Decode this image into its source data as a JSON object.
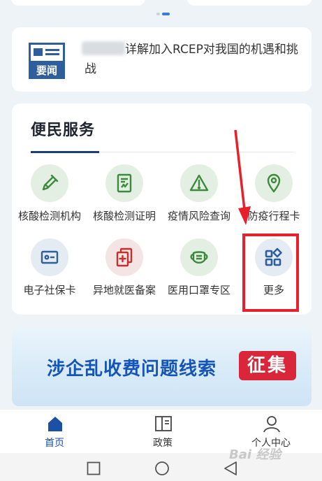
{
  "colors": {
    "brand_blue": "#1d4fa6",
    "accent_red": "#e8202b",
    "icon_green": "#3d8a3c",
    "icon_blue": "#2e5e9b",
    "icon_red": "#c2312e"
  },
  "carousel": {
    "active_index": 1,
    "count": 2
  },
  "news": {
    "icon": "news-headline-icon",
    "icon_label": "要闻",
    "text": "详解加入RCEP对我国的机遇和挑战"
  },
  "services": {
    "title": "便民服务",
    "items": [
      {
        "label": "核酸检测机构",
        "icon": "test-tube-icon"
      },
      {
        "label": "核酸检测证明",
        "icon": "certificate-icon"
      },
      {
        "label": "疫情风险查询",
        "icon": "warning-icon"
      },
      {
        "label": "防疫行程卡",
        "icon": "location-pin-icon"
      },
      {
        "label": "电子社保卡",
        "icon": "id-card-icon"
      },
      {
        "label": "异地就医备案",
        "icon": "medical-record-icon"
      },
      {
        "label": "医用口罩专区",
        "icon": "mask-icon"
      },
      {
        "label": "更多",
        "icon": "grid-more-icon"
      }
    ]
  },
  "banner": {
    "text": "涉企乱收费问题线索",
    "badge": "征集"
  },
  "tabbar": [
    {
      "label": "首页",
      "icon": "home-icon",
      "active": true
    },
    {
      "label": "政策",
      "icon": "book-icon",
      "active": false
    },
    {
      "label": "个人中心",
      "icon": "person-icon",
      "active": false
    }
  ],
  "system_nav": [
    "square-icon",
    "circle-icon",
    "back-triangle-icon"
  ],
  "watermark": "Bai 经验"
}
